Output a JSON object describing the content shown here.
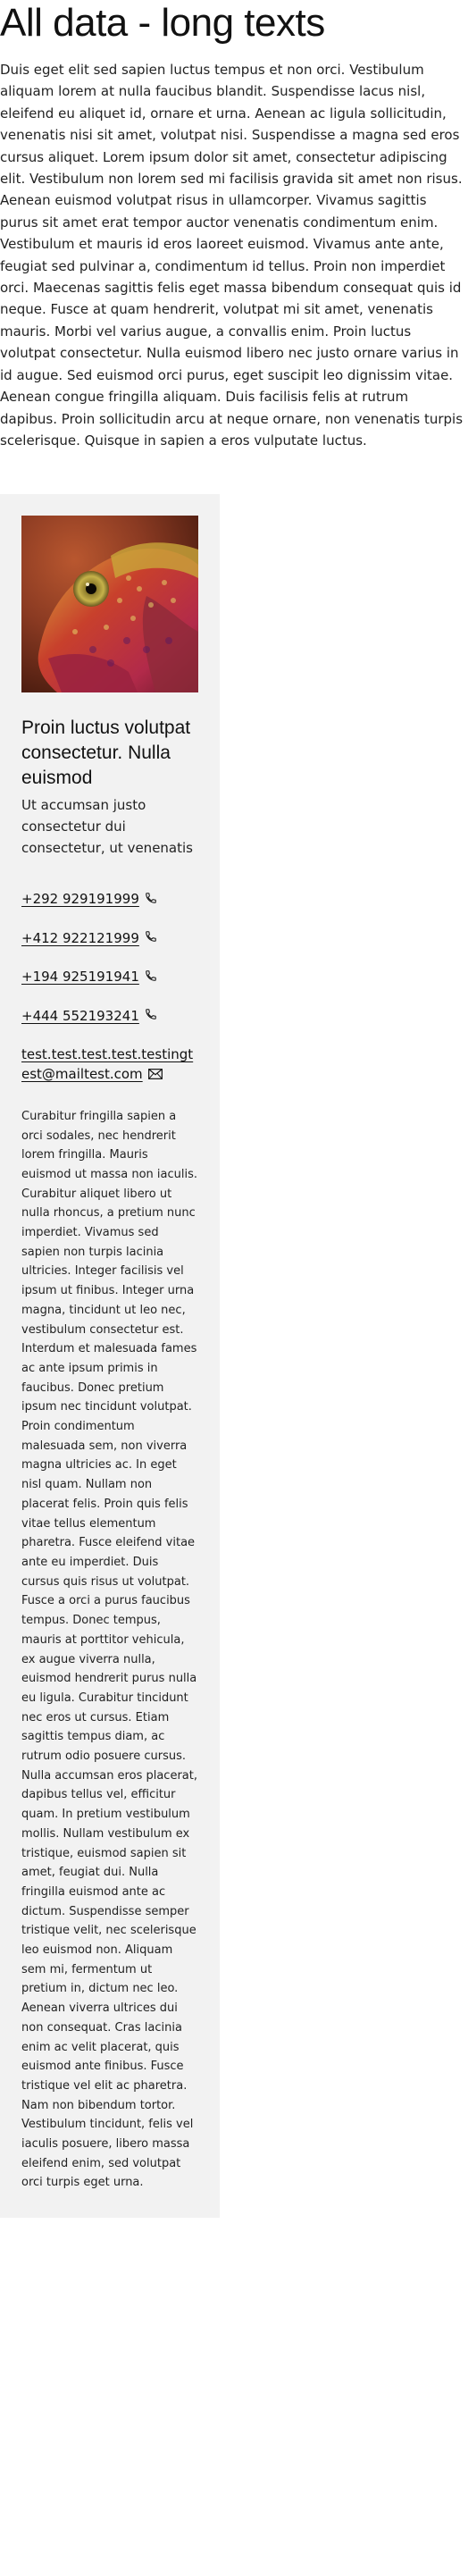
{
  "page": {
    "title": "All data - long texts",
    "intro": "Duis eget elit sed sapien luctus tempus et non orci. Vestibulum aliquam lorem at nulla faucibus blandit. Suspendisse lacus nisl, eleifend eu aliquet id, ornare et urna. Aenean ac ligula sollicitudin, venenatis nisi sit amet, volutpat nisi. Suspendisse a magna sed eros cursus aliquet. Lorem ipsum dolor sit amet, consectetur adipiscing elit. Vestibulum non lorem sed mi facilisis gravida sit amet non risus. Aenean euismod volutpat risus in ullamcorper. Vivamus sagittis purus sit amet erat tempor auctor venenatis condimentum enim. Vestibulum et mauris id eros laoreet euismod. Vivamus ante ante, feugiat sed pulvinar a, condimentum id tellus. Proin non imperdiet orci. Maecenas sagittis felis eget massa bibendum consequat quis id neque. Fusce at quam hendrerit, volutpat mi sit amet, venenatis mauris. Morbi vel varius augue, a convallis enim. Proin luctus volutpat consectetur. Nulla euismod libero nec justo ornare varius in id augue. Sed euismod orci purus, eget suscipit leo dignissim vitae. Aenean congue fringilla aliquam. Duis facilisis felis at rutrum dapibus. Proin sollicitudin arcu at neque ornare, non venenatis turpis scelerisque. Quisque in sapien a eros vulputate luctus."
  },
  "card": {
    "image_icon": "chameleon-photo",
    "name": "Proin luctus volutpat consectetur. Nulla euismod",
    "role": "Ut accumsan justo consectetur dui consectetur, ut venenatis",
    "phones": [
      "+292 929191999",
      "+412 922121999",
      "+194 925191941",
      "+444 552193241"
    ],
    "phone_icon": "phone-icon",
    "email": "test.test.test.test.testingtest@mailtest.com",
    "email_icon": "envelope-icon",
    "bio": "Curabitur fringilla sapien a orci sodales, nec hendrerit lorem fringilla. Mauris euismod ut massa non iaculis. Curabitur aliquet libero ut nulla rhoncus, a pretium nunc imperdiet. Vivamus sed sapien non turpis lacinia ultricies. Integer facilisis vel ipsum ut finibus. Integer urna magna, tincidunt ut leo nec, vestibulum consectetur est. Interdum et malesuada fames ac ante ipsum primis in faucibus. Donec pretium ipsum nec tincidunt volutpat. Proin condimentum malesuada sem, non viverra magna ultricies ac. In eget nisl quam. Nullam non placerat felis. Proin quis felis vitae tellus elementum pharetra. Fusce eleifend vitae ante eu imperdiet. Duis cursus quis risus ut volutpat. Fusce a orci a purus faucibus tempus. Donec tempus, mauris at porttitor vehicula, ex augue viverra nulla, euismod hendrerit purus nulla eu ligula. Curabitur tincidunt nec eros ut cursus. Etiam sagittis tempus diam, ac rutrum odio posuere cursus. Nulla accumsan eros placerat, dapibus tellus vel, efficitur quam. In pretium vestibulum mollis. Nullam vestibulum ex tristique, euismod sapien sit amet, feugiat dui. Nulla fringilla euismod ante ac dictum. Suspendisse semper tristique velit, nec scelerisque leo euismod non. Aliquam sem mi, fermentum ut pretium in, dictum nec leo. Aenean viverra ultrices dui non consequat. Cras lacinia enim ac velit placerat, quis euismod ante finibus. Fusce tristique vel elit ac pharetra. Nam non bibendum tortor. Vestibulum tincidunt, felis vel iaculis posuere, libero massa eleifend enim, sed volutpat orci turpis eget urna."
  }
}
